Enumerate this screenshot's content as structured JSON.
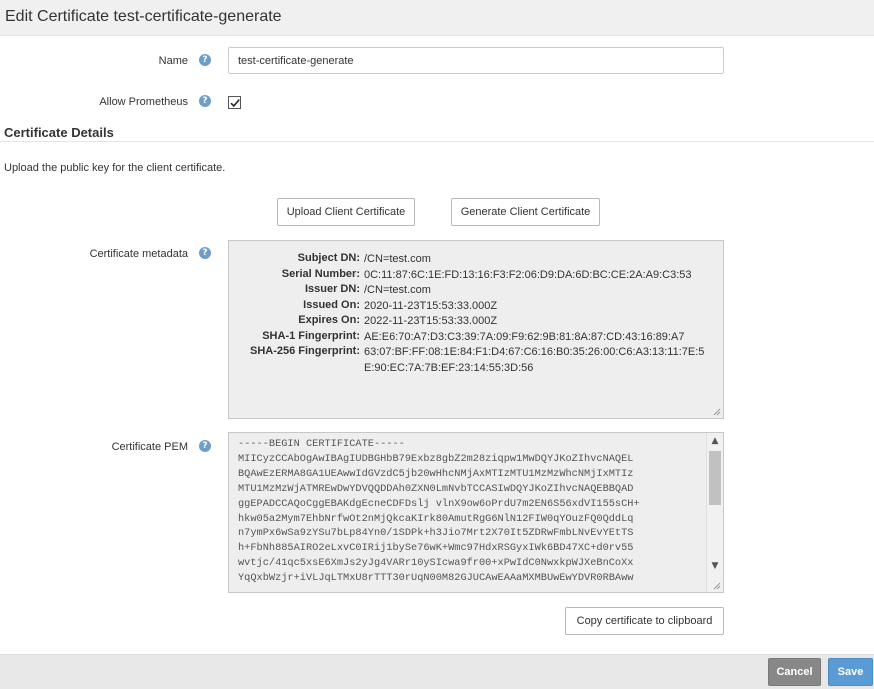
{
  "header": {
    "title": "Edit Certificate test-certificate-generate"
  },
  "form": {
    "name_label": "Name",
    "name_value": "test-certificate-generate",
    "prometheus_label": "Allow Prometheus",
    "prometheus_checked": true,
    "help_glyph": "?"
  },
  "details": {
    "title": "Certificate Details",
    "description": "Upload the public key for the client certificate.",
    "upload_button": "Upload Client Certificate",
    "generate_button": "Generate Client Certificate",
    "metadata_label": "Certificate metadata",
    "metadata": [
      {
        "key": "Subject DN:",
        "value": "/CN=test.com"
      },
      {
        "key": "Serial Number:",
        "value": "0C:11:87:6C:1E:FD:13:16:F3:F2:06:D9:DA:6D:BC:CE:2A:A9:C3:53"
      },
      {
        "key": "Issuer DN:",
        "value": "/CN=test.com"
      },
      {
        "key": "Issued On:",
        "value": "2020-11-23T15:53:33.000Z"
      },
      {
        "key": "Expires On:",
        "value": "2022-11-23T15:53:33.000Z"
      },
      {
        "key": "SHA-1 Fingerprint:",
        "value": "AE:E6:70:A7:D3:C3:39:7A:09:F9:62:9B:81:8A:87:CD:43:16:89:A7"
      },
      {
        "key": "SHA-256 Fingerprint:",
        "value": "63:07:BF:FF:08:1E:84:F1:D4:67:C6:16:B0:35:26:00:C6:A3:13:11:7E:5E:90:EC:7A:7B:EF:23:14:55:3D:56"
      }
    ],
    "pem_label": "Certificate PEM",
    "pem_text": "-----BEGIN CERTIFICATE-----\nMIICyzCCAbOgAwIBAgIUDBGHbB79Exbz8gbZ2m28ziqpw1MwDQYJKoZIhvcNAQEL\nBQAwEzERMA8GA1UEAwwIdGVzdC5jb20wHhcNMjAxMTIzMTU1MzMzWhcNMjIxMTIz\nMTU1MzMzWjATMREwDwYDVQQDDAh0ZXN0LmNvbTCCASIwDQYJKoZIhvcNAQEBBQAD\nggEPADCCAQoCggEBAKdgEcneCDFDslj vlnX9ow6oPrdU7m2EN6S56xdVI155sCH+\nhkw05a2Mym7EhbNrfwOt2nMjQkcaKIrk80AmutRgG6NlN12FIW0qYOuzFQ0QddLq\nn7ymPx6wSa9zYSu7bLp84Yn0/1SDPk+h3Jio7Mrt2X70It5ZDRwFmbLNvEvYEtTS\nh+FbNh885AIRO2eLxvC0IRij1bySe76wK+Wmc97HdxRSGyxIWk6BD47XC+d0rv55\nwvtjc/41qc5xsE6XmJs2yJg4VARr10ySIcwa9fr00+xPwIdC0NwxkpWJXeBnCoXx\nYqQxbWzjr+iVLJqLTMxU8rTTT30rUqN00M82GJUCAwEAAaMXMBUwEwYDVR0RBAww",
    "copy_button": "Copy certificate to clipboard"
  },
  "footer": {
    "cancel_label": "Cancel",
    "save_label": "Save"
  },
  "colors": {
    "save": "#5b9bd5",
    "cancel": "#888888",
    "help": "#6e9ec8"
  }
}
